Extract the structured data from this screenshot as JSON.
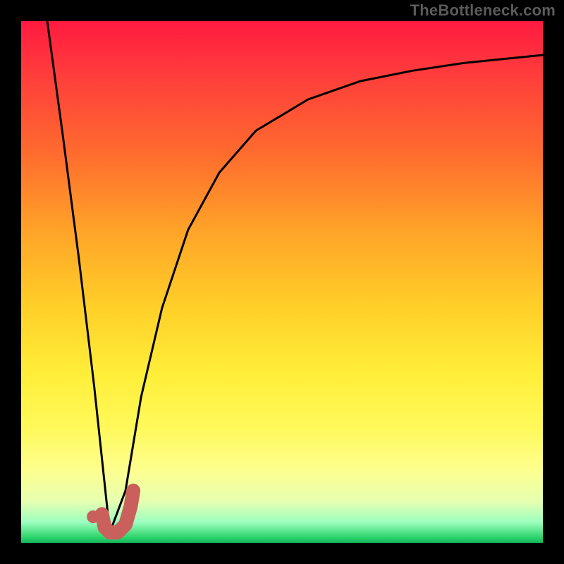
{
  "watermark": {
    "text": "TheBottleneck.com"
  },
  "chart_data": {
    "type": "line",
    "title": "",
    "xlabel": "",
    "ylabel": "",
    "xlim": [
      0,
      100
    ],
    "ylim": [
      0,
      100
    ],
    "grid": false,
    "legend": false,
    "series": [
      {
        "name": "bottleneck-curve",
        "color": "#000000",
        "comment": "black V-shaped curve; steep linear descent to ~x=17, then asymptotic rise",
        "x": [
          5,
          8,
          11,
          14,
          17,
          20,
          23,
          27,
          32,
          38,
          45,
          55,
          65,
          75,
          85,
          95,
          100
        ],
        "y": [
          100,
          78,
          55,
          30,
          2,
          10,
          28,
          45,
          60,
          71,
          79,
          85,
          88.5,
          90.5,
          92,
          93,
          93.5
        ]
      },
      {
        "name": "highlight-segment",
        "color": "#c9605c",
        "comment": "thick salmon J-shaped marker near the trough",
        "x": [
          15.5,
          16,
          17,
          18.5,
          20,
          21,
          21.5
        ],
        "y": [
          5.5,
          3,
          2,
          2,
          3.5,
          7,
          10
        ]
      },
      {
        "name": "highlight-dot",
        "color": "#c9605c",
        "comment": "small salmon dot just left of the J",
        "x": [
          13.8
        ],
        "y": [
          5
        ]
      }
    ],
    "background": {
      "type": "vertical-gradient",
      "stops": [
        {
          "pos": 0.0,
          "color": "#ff1a40"
        },
        {
          "pos": 0.25,
          "color": "#ff6a2e"
        },
        {
          "pos": 0.55,
          "color": "#ffd028"
        },
        {
          "pos": 0.78,
          "color": "#fff95a"
        },
        {
          "pos": 0.92,
          "color": "#e7ffb0"
        },
        {
          "pos": 1.0,
          "color": "#14b55a"
        }
      ]
    }
  }
}
